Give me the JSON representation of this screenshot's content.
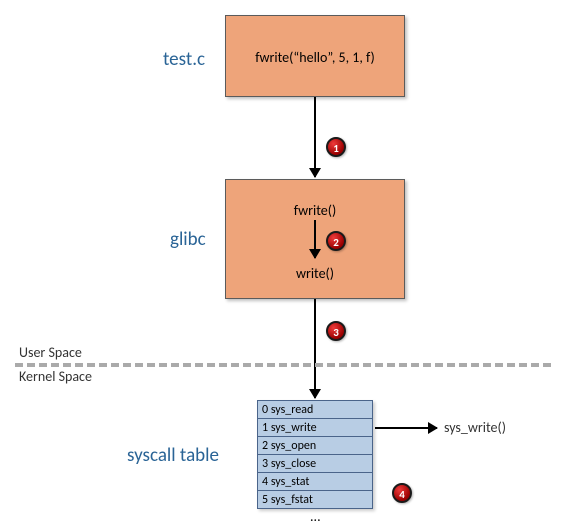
{
  "labels": {
    "testc": "test.c",
    "glibc": "glibc",
    "syscall_table": "syscall table",
    "user_space": "User Space",
    "kernel_space": "Kernel Space",
    "sys_write_call": "sys_write()",
    "ellipsis": "..."
  },
  "boxes": {
    "testc_content": "fwrite(“hello”, 5, 1, f)",
    "glibc_top": "fwrite()",
    "glibc_bottom": "write()"
  },
  "badges": {
    "b1": "1",
    "b2": "2",
    "b3": "3",
    "b4": "4"
  },
  "syscall_table": {
    "rows": [
      {
        "idx": "0",
        "name": "sys_read"
      },
      {
        "idx": "1",
        "name": "sys_write"
      },
      {
        "idx": "2",
        "name": "sys_open"
      },
      {
        "idx": "3",
        "name": "sys_close"
      },
      {
        "idx": "4",
        "name": "sys_stat"
      },
      {
        "idx": "5",
        "name": "sys_fstat"
      }
    ]
  },
  "chart_data": {
    "type": "diagram",
    "title": "",
    "nodes": [
      {
        "id": "testc",
        "label": "test.c",
        "content": "fwrite(\"hello\", 5, 1, f)",
        "space": "user"
      },
      {
        "id": "glibc",
        "label": "glibc",
        "content": [
          "fwrite()",
          "write()"
        ],
        "space": "user"
      },
      {
        "id": "syscall_table",
        "label": "syscall table",
        "content": [
          "0 sys_read",
          "1 sys_write",
          "2 sys_open",
          "3 sys_close",
          "4 sys_stat",
          "5 sys_fstat"
        ],
        "space": "kernel"
      },
      {
        "id": "sys_write_fn",
        "label": "sys_write()",
        "space": "kernel"
      }
    ],
    "edges": [
      {
        "from": "testc",
        "to": "glibc",
        "step": 1
      },
      {
        "from": "glibc.fwrite",
        "to": "glibc.write",
        "step": 2
      },
      {
        "from": "glibc",
        "to": "syscall_table",
        "step": 3,
        "crosses_boundary": "User Space / Kernel Space"
      },
      {
        "from": "syscall_table[1]",
        "to": "sys_write_fn",
        "step": 4
      }
    ],
    "boundary": {
      "upper": "User Space",
      "lower": "Kernel Space"
    }
  }
}
